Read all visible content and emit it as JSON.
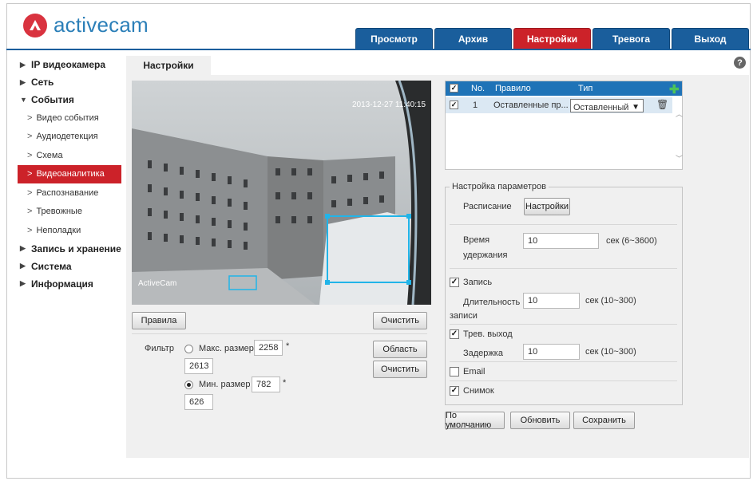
{
  "app": {
    "logo_text": "activecam",
    "brand_color": "#2b7fb8",
    "accent_color": "#cc2229",
    "nav_color": "#1a5e9c"
  },
  "nav": {
    "tabs": [
      {
        "label": "Просмотр",
        "active": false
      },
      {
        "label": "Архив",
        "active": false
      },
      {
        "label": "Настройки",
        "active": true
      },
      {
        "label": "Тревога",
        "active": false
      },
      {
        "label": "Выход",
        "active": false
      }
    ]
  },
  "sidebar": {
    "items": [
      {
        "label": "IP видеокамера",
        "level": 0,
        "expanded": false
      },
      {
        "label": "Сеть",
        "level": 0,
        "expanded": false
      },
      {
        "label": "События",
        "level": 0,
        "expanded": true
      },
      {
        "label": "Видео события",
        "level": 1
      },
      {
        "label": "Аудиодетекция",
        "level": 1
      },
      {
        "label": "Схема",
        "level": 1
      },
      {
        "label": "Видеоаналитика",
        "level": 1,
        "active": true
      },
      {
        "label": "Распознавание",
        "level": 1
      },
      {
        "label": "Тревожные",
        "level": 1
      },
      {
        "label": "Неполадки",
        "level": 1
      },
      {
        "label": "Запись и хранение",
        "level": 0,
        "expanded": false
      },
      {
        "label": "Система",
        "level": 0,
        "expanded": false
      },
      {
        "label": "Информация",
        "level": 0,
        "expanded": false
      }
    ]
  },
  "content": {
    "tab_label": "Настройки",
    "help_icon": "?"
  },
  "video": {
    "timestamp": "2013-12-27 11:40:15",
    "overlay_label": "ActiveCam"
  },
  "left_controls": {
    "rules_button": "Правила",
    "clear_button_1": "Очистить",
    "area_button": "Область",
    "clear_button_2": "Очистить",
    "filter_label": "Фильтр",
    "max_size": {
      "label": "Макс. размер",
      "selected": false,
      "width": "2258",
      "height": "2613",
      "separator": "*"
    },
    "min_size": {
      "label": "Мин. размер",
      "selected": true,
      "width": "782",
      "height": "626",
      "separator": "*"
    }
  },
  "rules_table": {
    "headers": {
      "checkbox": "✓",
      "no": "No.",
      "rule": "Правило",
      "type": "Тип"
    },
    "rows": [
      {
        "checked": true,
        "no": "1",
        "rule": "Оставленные пр...",
        "type": "Оставленный"
      }
    ]
  },
  "params": {
    "legend": "Настройка параметров",
    "schedule_label": "Расписание",
    "schedule_button": "Настройки",
    "hold_time_label_1": "Время",
    "hold_time_label_2": "удержания",
    "hold_time_value": "10",
    "hold_time_unit": "сек (6~3600)",
    "record": {
      "label": "Запись",
      "checked": true
    },
    "duration_label_1": "Длительность",
    "duration_label_2": "записи",
    "duration_value": "10",
    "duration_unit": "сек (10~300)",
    "alarm_out": {
      "label": "Трев. выход",
      "checked": true
    },
    "delay_label": "Задержка",
    "delay_value": "10",
    "delay_unit": "сек (10~300)",
    "email": {
      "label": "Email",
      "checked": false
    },
    "snapshot": {
      "label": "Снимок",
      "checked": true
    }
  },
  "footer_buttons": {
    "default": "По умолчанию",
    "refresh": "Обновить",
    "save": "Сохранить"
  }
}
